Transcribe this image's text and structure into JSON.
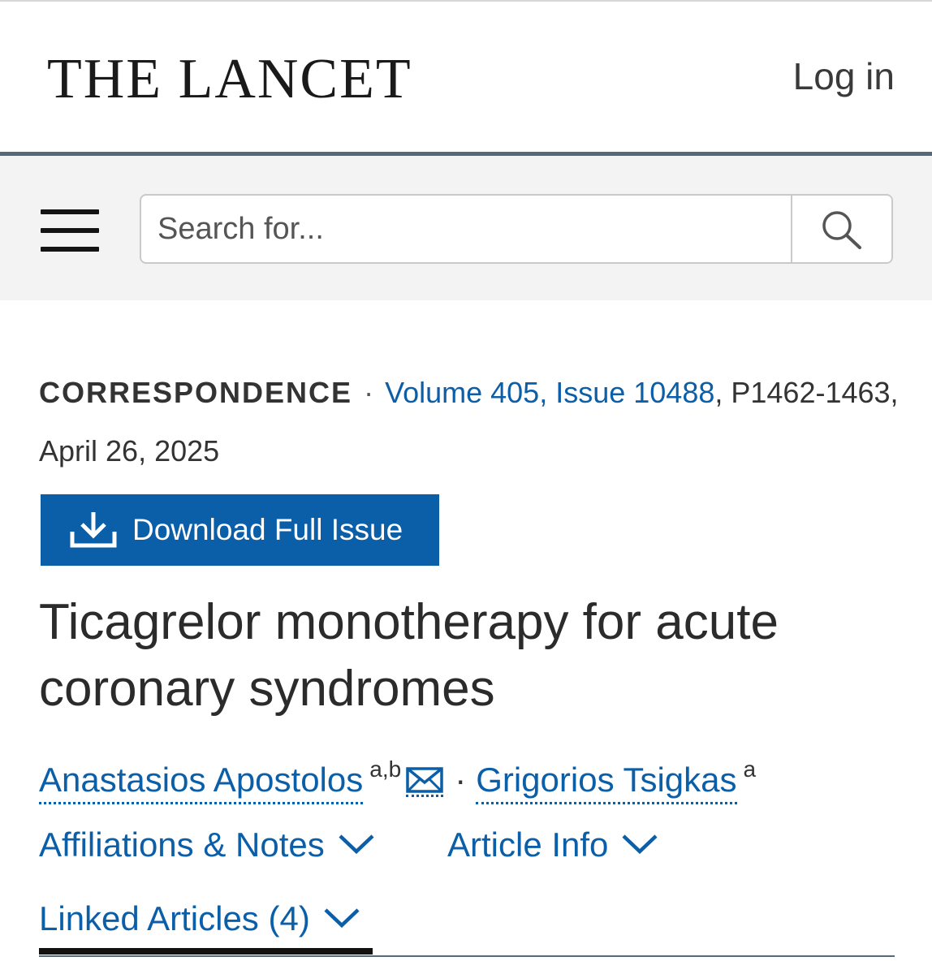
{
  "header": {
    "logo": "THE LANCET",
    "login_label": "Log in"
  },
  "search": {
    "placeholder": "Search for..."
  },
  "article": {
    "type": "CORRESPONDENCE",
    "volume_issue": "Volume 405, Issue 10488",
    "pages_date": ", P1462-1463, April 26, 2025",
    "download_label": "Download Full Issue",
    "title": "Ticagrelor monotherapy for acute coronary syndromes",
    "authors": [
      {
        "name": "Anastasios Apostolos",
        "affiliations": "a,b"
      },
      {
        "name": "Grigorios Tsigkas",
        "affiliations": "a"
      }
    ],
    "separator": "·"
  },
  "tabs": {
    "affiliations": "Affiliations & Notes",
    "article_info": "Article Info",
    "linked_articles": "Linked Articles (4)"
  },
  "colors": {
    "link_blue": "#0b5ea8",
    "header_rule": "#546a7b",
    "search_band": "#f3f3f3"
  },
  "icons": [
    "hamburger-menu-icon",
    "search-icon",
    "download-icon",
    "envelope-icon",
    "chevron-down-icon"
  ]
}
